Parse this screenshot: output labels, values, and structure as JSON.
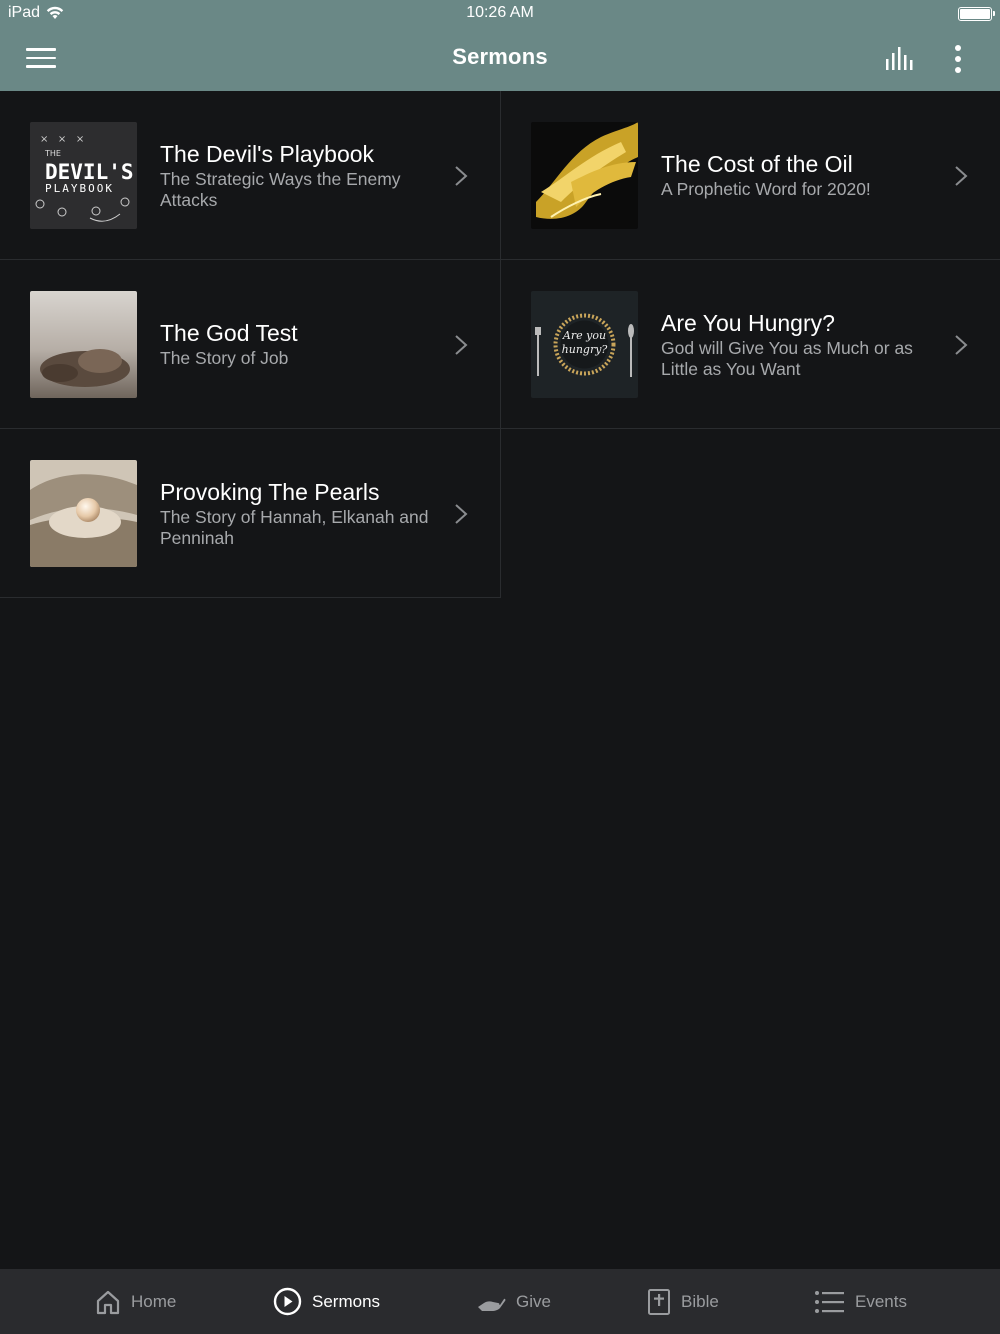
{
  "status": {
    "device": "iPad",
    "time": "10:26 AM"
  },
  "header": {
    "title": "Sermons"
  },
  "sermons": [
    {
      "title": "The Devil's Playbook",
      "subtitle": "The Strategic Ways the Enemy Attacks",
      "art": {
        "line1": "THE",
        "line2": "DEVIL'S",
        "line3": "PLAYBOOK"
      }
    },
    {
      "title": "The Cost of the Oil",
      "subtitle": "A Prophetic Word for 2020!"
    },
    {
      "title": "The God Test",
      "subtitle": "The Story of Job"
    },
    {
      "title": "Are You Hungry?",
      "subtitle": "God will Give You as Much or as Little as You Want",
      "art": {
        "line1": "Are you",
        "line2": "hungry?"
      }
    },
    {
      "title": "Provoking The Pearls",
      "subtitle": "The Story of Hannah, Elkanah and Penninah"
    }
  ],
  "tabs": [
    {
      "label": "Home",
      "icon": "home-icon"
    },
    {
      "label": "Sermons",
      "icon": "play-circle-icon",
      "active": true
    },
    {
      "label": "Give",
      "icon": "give-hand-icon"
    },
    {
      "label": "Bible",
      "icon": "bible-icon"
    },
    {
      "label": "Events",
      "icon": "list-icon"
    }
  ],
  "colors": {
    "header": "#6a8886",
    "background": "#141517",
    "tabbar": "#2a2b2e",
    "muted_text": "#a7a9ac"
  }
}
